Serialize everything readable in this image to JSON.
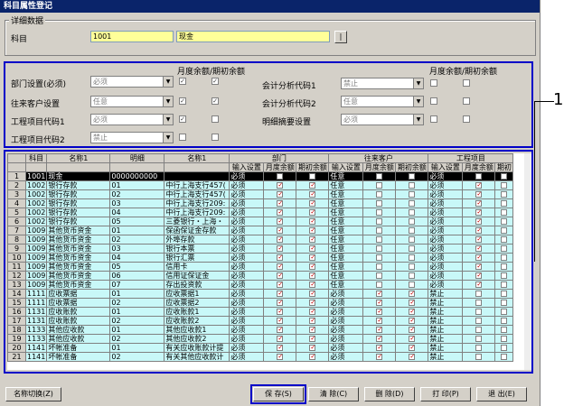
{
  "window": {
    "title": "科目属性登记"
  },
  "details": {
    "group_title": "详细数据",
    "subject_label": "科目",
    "subject_code": "1001",
    "subject_name": "现金",
    "browse_label": "|"
  },
  "settings": {
    "header_left": "月度余额/期初余额",
    "header_right": "月度余额/期初余额",
    "left": [
      {
        "label": "部门设置(必须)",
        "value": "必须",
        "c1": "✓",
        "c2": "✓"
      },
      {
        "label": "往来客户设置",
        "value": "任意",
        "c1": "✓",
        "c2": "✓"
      },
      {
        "label": "工程项目代码1",
        "value": "必须",
        "c1": "✓",
        "c2": ""
      },
      {
        "label": "工程项目代码2",
        "value": "禁止",
        "c1": "",
        "c2": ""
      }
    ],
    "right": [
      {
        "label": "会计分析代码1",
        "value": "禁止"
      },
      {
        "label": "会计分析代码2",
        "value": "任意"
      },
      {
        "label": "明细摘要设置",
        "value": "必须"
      }
    ]
  },
  "grid": {
    "headers_top": [
      "科目",
      "名称1",
      "明细",
      "名称1",
      "部门",
      "往来客户",
      "工程项目"
    ],
    "headers_sub": [
      "输入设置",
      "月度余额",
      "期初余额",
      "输入设置",
      "月度余额",
      "期初余额",
      "输入设置",
      "月度余额",
      "期初"
    ],
    "rows": [
      {
        "n": "1",
        "code": "1001",
        "name": "现金",
        "detail": "0000000000",
        "dname": "",
        "d1": "必须",
        "c1": "",
        "c2": "",
        "k1": "任意",
        "c3": "",
        "c4": "",
        "p1": "必须",
        "c5": "",
        "c6": ""
      },
      {
        "n": "2",
        "code": "1002",
        "name": "银行存款",
        "detail": "01",
        "dname": "中行上海支行457(",
        "d1": "必须",
        "c1": "✓",
        "c2": "✓",
        "k1": "任意",
        "c3": "",
        "c4": "",
        "p1": "必须",
        "c5": "✓",
        "c6": ""
      },
      {
        "n": "3",
        "code": "1002",
        "name": "银行存款",
        "detail": "02",
        "dname": "中行上海支行457(",
        "d1": "必须",
        "c1": "✓",
        "c2": "✓",
        "k1": "任意",
        "c3": "",
        "c4": "",
        "p1": "必须",
        "c5": "✓",
        "c6": ""
      },
      {
        "n": "4",
        "code": "1002",
        "name": "银行存款",
        "detail": "03",
        "dname": "中行上海支行209:",
        "d1": "必须",
        "c1": "✓",
        "c2": "✓",
        "k1": "任意",
        "c3": "",
        "c4": "",
        "p1": "必须",
        "c5": "✓",
        "c6": ""
      },
      {
        "n": "5",
        "code": "1002",
        "name": "银行存款",
        "detail": "04",
        "dname": "中行上海支行209:",
        "d1": "必须",
        "c1": "✓",
        "c2": "✓",
        "k1": "任意",
        "c3": "",
        "c4": "",
        "p1": "必须",
        "c5": "✓",
        "c6": ""
      },
      {
        "n": "6",
        "code": "1002",
        "name": "银行存款",
        "detail": "05",
        "dname": "三菱银行・上海・",
        "d1": "必须",
        "c1": "✓",
        "c2": "✓",
        "k1": "任意",
        "c3": "",
        "c4": "",
        "p1": "必须",
        "c5": "✓",
        "c6": ""
      },
      {
        "n": "7",
        "code": "1009",
        "name": "其他货币资金",
        "detail": "01",
        "dname": "保函保证金存款",
        "d1": "必须",
        "c1": "✓",
        "c2": "✓",
        "k1": "任意",
        "c3": "",
        "c4": "",
        "p1": "必须",
        "c5": "✓",
        "c6": ""
      },
      {
        "n": "8",
        "code": "1009",
        "name": "其他货币资金",
        "detail": "02",
        "dname": "外埠存款",
        "d1": "必须",
        "c1": "✓",
        "c2": "✓",
        "k1": "任意",
        "c3": "",
        "c4": "",
        "p1": "必须",
        "c5": "✓",
        "c6": ""
      },
      {
        "n": "9",
        "code": "1009",
        "name": "其他货币资金",
        "detail": "03",
        "dname": "银行本票",
        "d1": "必须",
        "c1": "✓",
        "c2": "✓",
        "k1": "任意",
        "c3": "",
        "c4": "",
        "p1": "必须",
        "c5": "✓",
        "c6": ""
      },
      {
        "n": "10",
        "code": "1009",
        "name": "其他货币资金",
        "detail": "04",
        "dname": "银行汇票",
        "d1": "必须",
        "c1": "✓",
        "c2": "✓",
        "k1": "任意",
        "c3": "",
        "c4": "",
        "p1": "必须",
        "c5": "✓",
        "c6": ""
      },
      {
        "n": "11",
        "code": "1009",
        "name": "其他货币资金",
        "detail": "05",
        "dname": "信用卡",
        "d1": "必须",
        "c1": "✓",
        "c2": "✓",
        "k1": "任意",
        "c3": "",
        "c4": "",
        "p1": "必须",
        "c5": "✓",
        "c6": ""
      },
      {
        "n": "12",
        "code": "1009",
        "name": "其他货币资金",
        "detail": "06",
        "dname": "信用证保证金",
        "d1": "必须",
        "c1": "✓",
        "c2": "✓",
        "k1": "任意",
        "c3": "",
        "c4": "",
        "p1": "必须",
        "c5": "✓",
        "c6": ""
      },
      {
        "n": "13",
        "code": "1009",
        "name": "其他货币资金",
        "detail": "07",
        "dname": "存出投资款",
        "d1": "必须",
        "c1": "✓",
        "c2": "✓",
        "k1": "任意",
        "c3": "",
        "c4": "",
        "p1": "必须",
        "c5": "✓",
        "c6": ""
      },
      {
        "n": "14",
        "code": "1111",
        "name": "应收票据",
        "detail": "01",
        "dname": "应收票据1",
        "d1": "必须",
        "c1": "✓",
        "c2": "✓",
        "k1": "必须",
        "c3": "✓",
        "c4": "✓",
        "p1": "禁止",
        "c5": "",
        "c6": ""
      },
      {
        "n": "15",
        "code": "1111",
        "name": "应收票据",
        "detail": "02",
        "dname": "应收票据2",
        "d1": "必须",
        "c1": "✓",
        "c2": "✓",
        "k1": "必须",
        "c3": "✓",
        "c4": "✓",
        "p1": "禁止",
        "c5": "",
        "c6": ""
      },
      {
        "n": "16",
        "code": "1131",
        "name": "应收账款",
        "detail": "01",
        "dname": "应收账款1",
        "d1": "必须",
        "c1": "✓",
        "c2": "✓",
        "k1": "必须",
        "c3": "✓",
        "c4": "✓",
        "p1": "禁止",
        "c5": "",
        "c6": ""
      },
      {
        "n": "17",
        "code": "1131",
        "name": "应收账款",
        "detail": "02",
        "dname": "应收账款2",
        "d1": "必须",
        "c1": "✓",
        "c2": "✓",
        "k1": "必须",
        "c3": "✓",
        "c4": "✓",
        "p1": "禁止",
        "c5": "",
        "c6": ""
      },
      {
        "n": "18",
        "code": "1133",
        "name": "其他应收款",
        "detail": "01",
        "dname": "其他应收款1",
        "d1": "必须",
        "c1": "✓",
        "c2": "✓",
        "k1": "必须",
        "c3": "✓",
        "c4": "✓",
        "p1": "禁止",
        "c5": "",
        "c6": ""
      },
      {
        "n": "19",
        "code": "1133",
        "name": "其他应收款",
        "detail": "02",
        "dname": "其他应收款2",
        "d1": "必须",
        "c1": "✓",
        "c2": "✓",
        "k1": "必须",
        "c3": "✓",
        "c4": "✓",
        "p1": "禁止",
        "c5": "",
        "c6": ""
      },
      {
        "n": "20",
        "code": "1141",
        "name": "坏帐准备",
        "detail": "01",
        "dname": "有关应收账款计提",
        "d1": "必须",
        "c1": "✓",
        "c2": "✓",
        "k1": "必须",
        "c3": "✓",
        "c4": "✓",
        "p1": "禁止",
        "c5": "",
        "c6": ""
      },
      {
        "n": "21",
        "code": "1141",
        "name": "坏帐准备",
        "detail": "02",
        "dname": "有关其他应收款计",
        "d1": "必须",
        "c1": "✓",
        "c2": "✓",
        "k1": "必须",
        "c3": "✓",
        "c4": "✓",
        "p1": "禁止",
        "c5": "",
        "c6": ""
      }
    ]
  },
  "buttons": {
    "switch_name": "名称切换(Z)",
    "save": "保 存(S)",
    "clear": "清 除(C)",
    "delete": "删 除(D)",
    "print": "打 印(P)",
    "exit": "退 出(E)"
  },
  "callout": {
    "number": "1"
  }
}
